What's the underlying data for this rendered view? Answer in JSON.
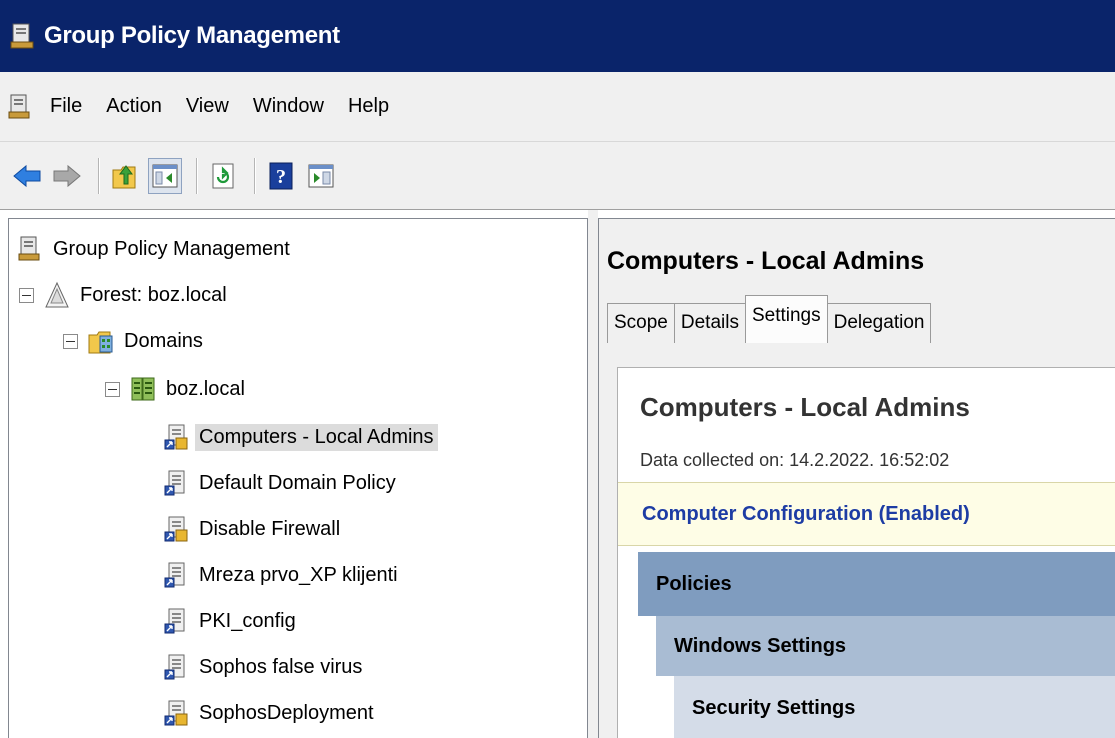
{
  "window": {
    "title": "Group Policy Management"
  },
  "menu": [
    "File",
    "Action",
    "View",
    "Window",
    "Help"
  ],
  "toolbar": {
    "buttons": [
      "back-arrow-icon",
      "forward-arrow-icon",
      "up-folder-icon",
      "show-hide-tree-icon",
      "refresh-icon",
      "help-icon",
      "action-pane-icon"
    ]
  },
  "tree": {
    "root": "Group Policy Management",
    "forest": "Forest: boz.local",
    "domains": "Domains",
    "domain": "boz.local",
    "gpos": [
      "Computers - Local Admins",
      "Default Domain Policy",
      "Disable Firewall",
      "Mreza prvo_XP klijenti",
      "PKI_config",
      "Sophos false virus",
      "SophosDeployment"
    ],
    "selected": "Computers - Local Admins"
  },
  "details": {
    "header": "Computers - Local Admins",
    "tabs": [
      "Scope",
      "Details",
      "Settings",
      "Delegation"
    ],
    "active_tab": "Settings",
    "report": {
      "title": "Computers - Local Admins",
      "date": "Data collected on: 14.2.2022. 16:52:02",
      "config": "Computer Configuration (Enabled)",
      "sections": [
        "Policies",
        "Windows Settings",
        "Security Settings"
      ]
    }
  },
  "colors": {
    "titlebar": "#0a246a",
    "config_text": "#1d3ca4",
    "policies_bar": "#7f9cbf",
    "windows_bar": "#a9bcd3",
    "security_bar": "#d4dce8"
  }
}
